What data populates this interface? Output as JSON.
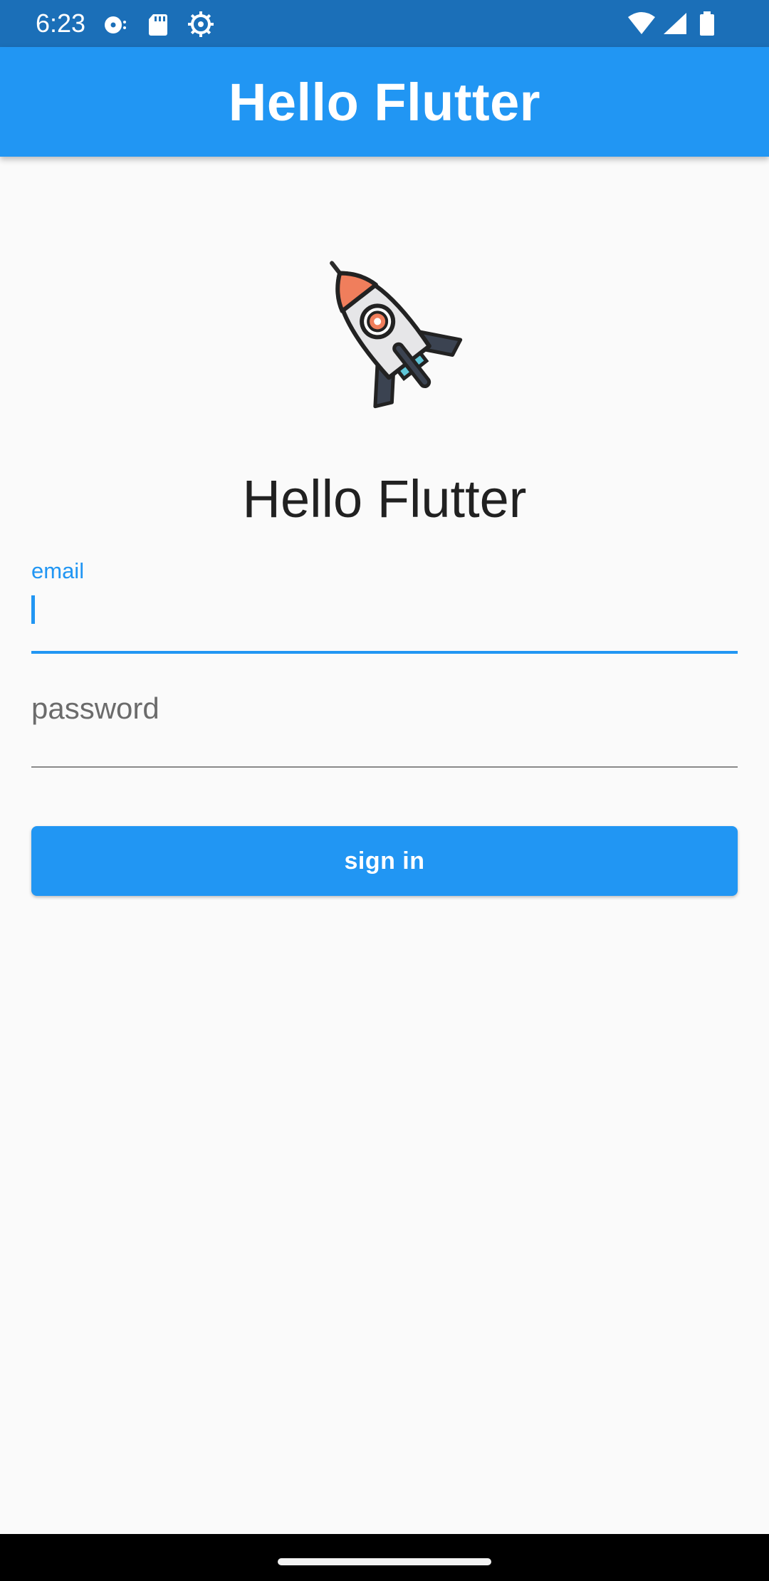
{
  "status_bar": {
    "time": "6:23",
    "icons": [
      "media-icon",
      "sd-card-icon",
      "settings-gear-icon",
      "wifi-icon",
      "cell-signal-icon",
      "battery-icon"
    ]
  },
  "app_bar": {
    "title": "Hello Flutter"
  },
  "logo": {
    "icon": "rocket-icon"
  },
  "main": {
    "heading": "Hello Flutter"
  },
  "form": {
    "email": {
      "label": "email",
      "value": ""
    },
    "password": {
      "placeholder": "password",
      "value": ""
    },
    "submit_label": "sign in"
  },
  "colors": {
    "primary": "#2196f3",
    "status_bar": "#1b6fb8",
    "background": "#fafafa"
  }
}
